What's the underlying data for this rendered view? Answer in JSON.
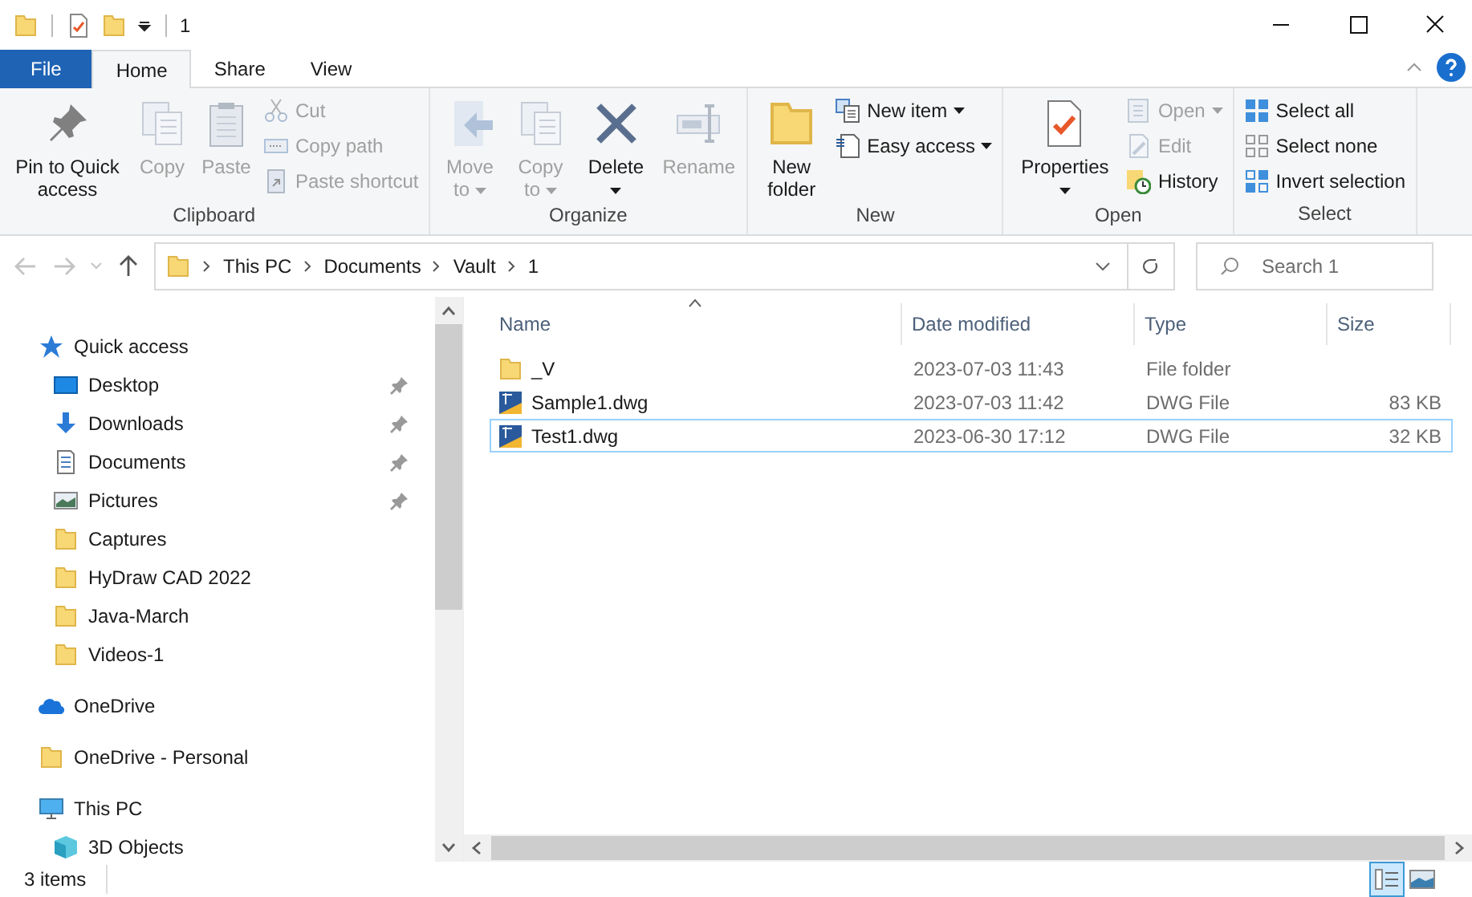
{
  "title_bar": {
    "title": "1"
  },
  "tabs": [
    {
      "label": "File",
      "kind": "file",
      "selected": false
    },
    {
      "label": "Home",
      "kind": "tab",
      "selected": true
    },
    {
      "label": "Share",
      "kind": "tab",
      "selected": false
    },
    {
      "label": "View",
      "kind": "tab",
      "selected": false
    }
  ],
  "ribbon": [
    {
      "label": "Clipboard",
      "items": [
        {
          "label": "Pin to Quick access",
          "kind": "large",
          "disabled": false,
          "dropdown": false
        },
        {
          "label": "Copy",
          "kind": "large",
          "disabled": true,
          "dropdown": false
        },
        {
          "label": "Paste",
          "kind": "large",
          "disabled": true,
          "dropdown": false
        },
        {
          "label": "Cut",
          "kind": "small",
          "disabled": true,
          "dropdown": false
        },
        {
          "label": "Copy path",
          "kind": "small",
          "disabled": true,
          "dropdown": false
        },
        {
          "label": "Paste shortcut",
          "kind": "small",
          "disabled": true,
          "dropdown": false
        }
      ]
    },
    {
      "label": "Organize",
      "items": [
        {
          "label": "Move to",
          "kind": "large",
          "disabled": true,
          "dropdown": true
        },
        {
          "label": "Copy to",
          "kind": "large",
          "disabled": true,
          "dropdown": true
        },
        {
          "label": "Delete",
          "kind": "large",
          "disabled": false,
          "dropdown": true
        },
        {
          "label": "Rename",
          "kind": "large",
          "disabled": true,
          "dropdown": false
        }
      ]
    },
    {
      "label": "New",
      "items": [
        {
          "label": "New folder",
          "kind": "large",
          "disabled": false,
          "dropdown": false
        },
        {
          "label": "New item",
          "kind": "small",
          "disabled": false,
          "dropdown": true
        },
        {
          "label": "Easy access",
          "kind": "small",
          "disabled": false,
          "dropdown": true
        }
      ]
    },
    {
      "label": "Open",
      "items": [
        {
          "label": "Properties",
          "kind": "large",
          "disabled": false,
          "dropdown": true
        },
        {
          "label": "Open",
          "kind": "small",
          "disabled": true,
          "dropdown": true
        },
        {
          "label": "Edit",
          "kind": "small",
          "disabled": true,
          "dropdown": false
        },
        {
          "label": "History",
          "kind": "small",
          "disabled": false,
          "dropdown": false
        }
      ]
    },
    {
      "label": "Select",
      "items": [
        {
          "label": "Select all",
          "kind": "small",
          "disabled": false,
          "dropdown": false
        },
        {
          "label": "Select none",
          "kind": "small",
          "disabled": false,
          "dropdown": false
        },
        {
          "label": "Invert selection",
          "kind": "small",
          "disabled": false,
          "dropdown": false
        }
      ]
    }
  ],
  "address": {
    "path": [
      "This PC",
      "Documents",
      "Vault",
      "1"
    ]
  },
  "search": {
    "placeholder": "Search 1"
  },
  "sidebar": {
    "items": [
      {
        "label": "Quick access",
        "children": [
          {
            "label": "Desktop",
            "pinned": true
          },
          {
            "label": "Downloads",
            "pinned": true
          },
          {
            "label": "Documents",
            "pinned": true
          },
          {
            "label": "Pictures",
            "pinned": true
          },
          {
            "label": "Captures",
            "pinned": false
          },
          {
            "label": "HyDraw CAD 2022",
            "pinned": false
          },
          {
            "label": "Java-March",
            "pinned": false
          },
          {
            "label": "Videos-1",
            "pinned": false
          }
        ]
      },
      {
        "label": "OneDrive"
      },
      {
        "label": "OneDrive - Personal"
      },
      {
        "label": "This PC",
        "children": [
          {
            "label": "3D Objects"
          }
        ]
      }
    ]
  },
  "table": {
    "columns": [
      {
        "label": "Name",
        "sorted": true
      },
      {
        "label": "Date modified",
        "sorted": false
      },
      {
        "label": "Type",
        "sorted": false
      },
      {
        "label": "Size",
        "sorted": false
      }
    ],
    "rows": [
      {
        "kind": "folder",
        "name": "_V",
        "date": "2023-07-03 11:43",
        "type": "File folder",
        "selected": false
      },
      {
        "kind": "file",
        "name": "Sample1.dwg",
        "date": "2023-07-03 11:42",
        "type": "DWG File",
        "size": "83 KB",
        "selected": false
      },
      {
        "kind": "file",
        "name": "Test1.dwg",
        "date": "2023-06-30 17:12",
        "type": "DWG File",
        "size": "32 KB",
        "selected": true
      }
    ]
  },
  "status_bar": {
    "count": "3 items",
    "views": [
      {
        "kind": "details",
        "selected": true
      },
      {
        "kind": "large-icons",
        "selected": false
      }
    ]
  }
}
